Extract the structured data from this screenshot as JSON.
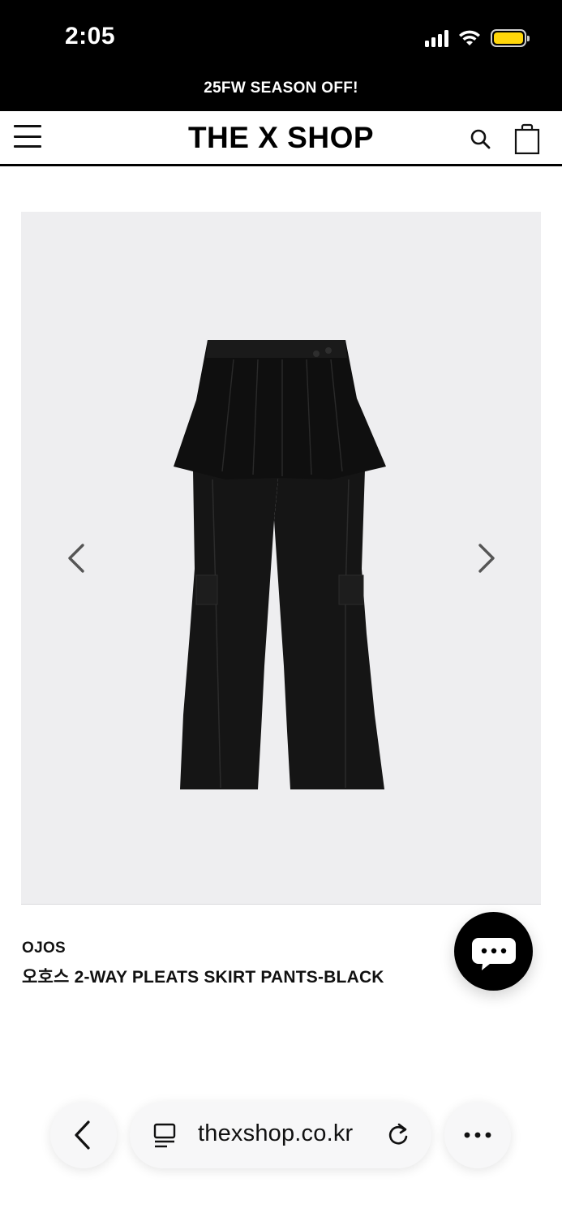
{
  "status_bar": {
    "time": "2:05",
    "battery_color": "#ffd60a"
  },
  "promo_banner": {
    "text": "25FW SEASON OFF!"
  },
  "header": {
    "logo": "THE X SHOP",
    "menu_icon": "hamburger-icon",
    "search_icon": "search-icon",
    "cart_icon": "shopping-bag-icon"
  },
  "gallery": {
    "prev_icon": "chevron-left-icon",
    "next_icon": "chevron-right-icon",
    "image_subject": "black pleats skirt pants",
    "background_color": "#eeeef0"
  },
  "product": {
    "brand": "OJOS",
    "name": "오호스 2-WAY PLEATS SKIRT PANTS-BLACK"
  },
  "chat": {
    "icon": "chat-bubble-icon"
  },
  "browser": {
    "url": "thexshop.co.kr",
    "back_icon": "chevron-left-icon",
    "reader_icon": "reader-mode-icon",
    "reload_icon": "reload-icon",
    "more_icon": "more-icon"
  }
}
